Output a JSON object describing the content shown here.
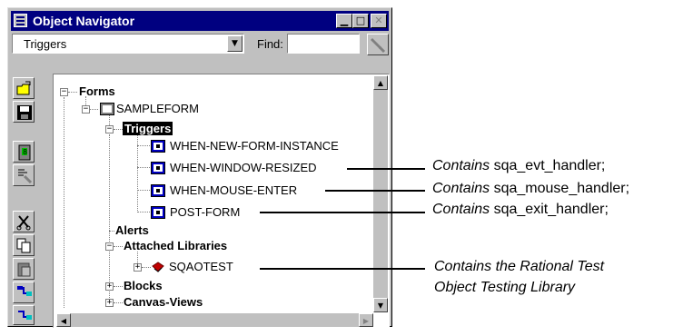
{
  "window": {
    "title": "Object Navigator",
    "caption_buttons": {
      "minimize": "▁",
      "maximize": "□",
      "close": "✕"
    }
  },
  "toolbar": {
    "filter_value": "Triggers",
    "find_label": "Find:",
    "find_value": ""
  },
  "sidebar": {
    "buttons": [
      "open-folder-icon",
      "save-disk-icon",
      "run-icon",
      "debug-icon",
      "cut-icon",
      "copy-icon",
      "paste-icon",
      "create-icon",
      "delete-icon"
    ]
  },
  "tree": {
    "forms": "Forms",
    "sampleform": "SAMPLEFORM",
    "triggers": "Triggers",
    "trigger_items": [
      "WHEN-NEW-FORM-INSTANCE",
      "WHEN-WINDOW-RESIZED",
      "WHEN-MOUSE-ENTER",
      "POST-FORM"
    ],
    "alerts": "Alerts",
    "attached_libraries": "Attached Libraries",
    "sqaotest": "SQAOTEST",
    "blocks": "Blocks",
    "canvas_views": "Canvas-Views"
  },
  "callouts": {
    "resized": {
      "prefix": "Contains",
      "handler": " sqa_evt_handler;"
    },
    "mouse": {
      "prefix": "Contains",
      "handler": " sqa_mouse_handler;"
    },
    "post": {
      "prefix": "Contains",
      "handler": " sqa_exit_handler;"
    },
    "library": {
      "line1": "Contains the Rational Test",
      "line2": "Object Testing Library"
    }
  },
  "colors": {
    "titlebar": "#000080",
    "face": "#c0c0c0",
    "selection": "#000000"
  }
}
